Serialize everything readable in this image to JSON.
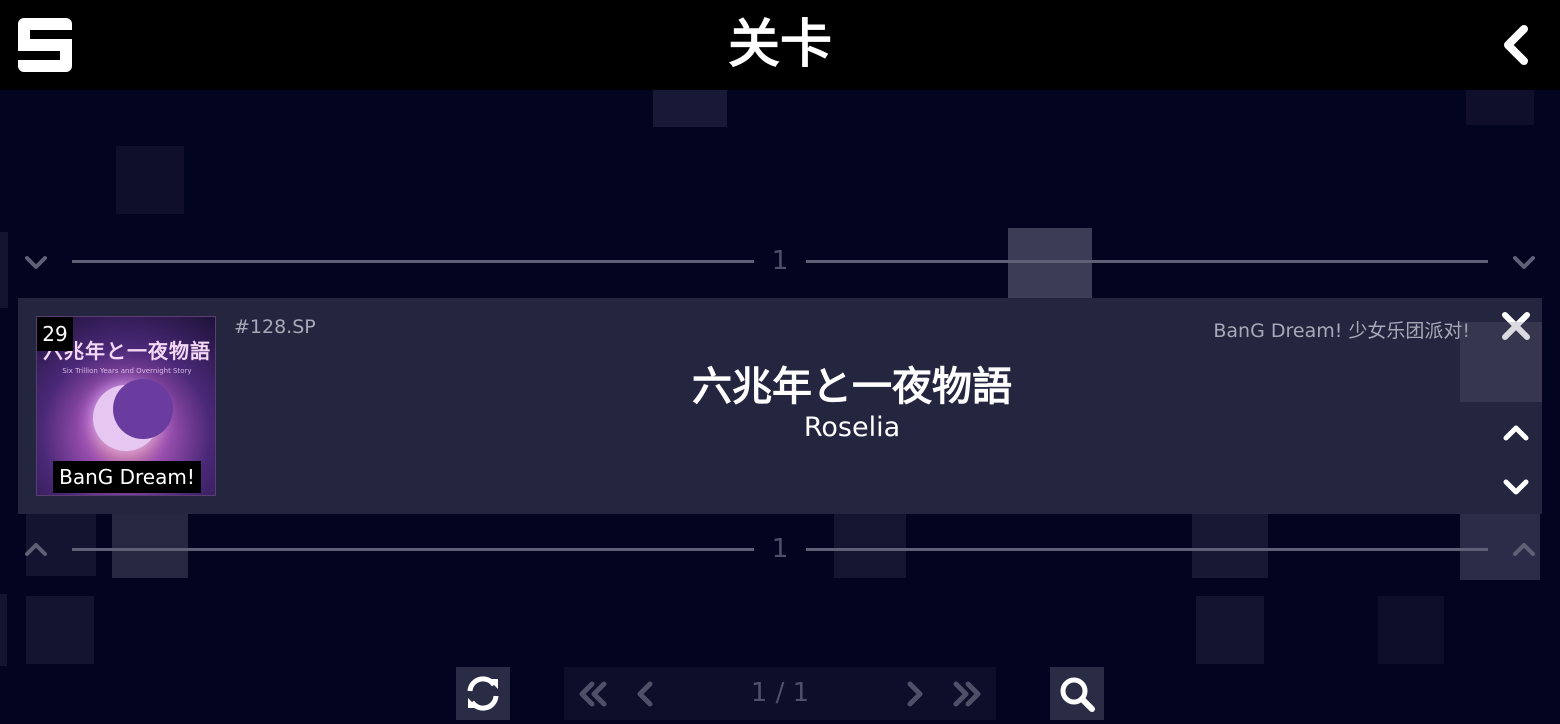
{
  "header": {
    "title": "关卡"
  },
  "divider_top": {
    "number": "1"
  },
  "divider_bottom": {
    "number": "1"
  },
  "level_card": {
    "level_number": "29",
    "level_id": "#128.SP",
    "title": "六兆年と一夜物語",
    "artist": "Roselia",
    "pack": "BanG Dream! 少女乐团派对!",
    "cover": {
      "title": "六兆年と一夜物語",
      "subtitle": "Six Trillion Years and Overnight Story",
      "source_badge": "BanG Dream!"
    }
  },
  "pagination": {
    "label": "1 / 1"
  },
  "icons": {
    "logo": "s-logo-icon",
    "back": "chevron-left-icon",
    "collapse": "chevron-down-icon",
    "expand": "chevron-up-icon",
    "close": "close-icon",
    "move_up": "chevron-up-icon",
    "move_down": "chevron-down-icon",
    "refresh": "refresh-icon",
    "first": "double-chevron-left-icon",
    "prev": "chevron-left-icon",
    "next": "chevron-right-icon",
    "last": "double-chevron-right-icon",
    "search": "search-icon"
  },
  "colors": {
    "background": "#030420",
    "topbar": "#000000",
    "card": "#24253e",
    "divider": "#5f6075",
    "muted_text": "#a8a9b8"
  }
}
